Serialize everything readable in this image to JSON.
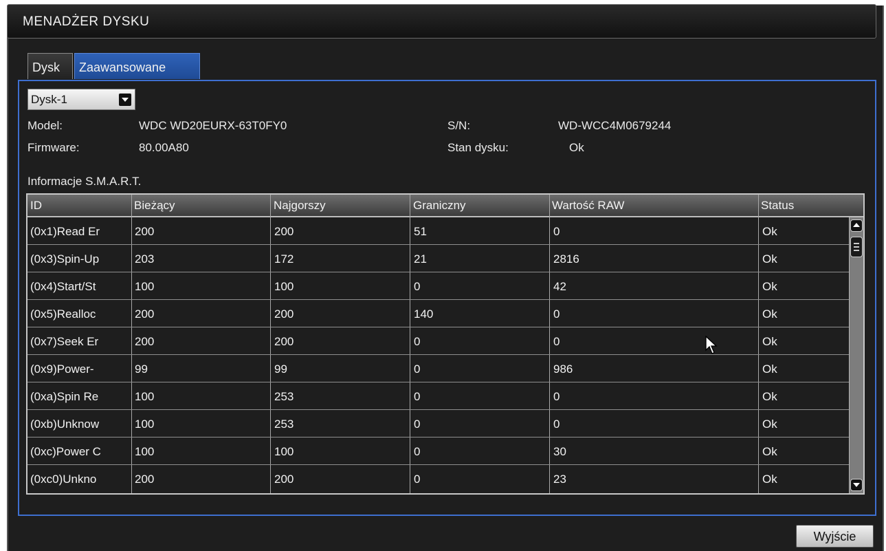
{
  "window": {
    "title": "MENADŻER DYSKU"
  },
  "tabs": [
    {
      "label": "Dysk"
    },
    {
      "label": "Zaawansowane"
    }
  ],
  "disk_select": {
    "value": "Dysk-1"
  },
  "info": {
    "model_label": "Model:",
    "model_value": "WDC WD20EURX-63T0FY0",
    "sn_label": "S/N:",
    "sn_value": "WD-WCC4M0679244",
    "firmware_label": "Firmware:",
    "firmware_value": "80.00A80",
    "status_label": "Stan dysku:",
    "status_value": "Ok"
  },
  "smart": {
    "heading": "Informacje S.M.A.R.T.",
    "columns": [
      "ID",
      "Bieżący",
      "Najgorszy",
      "Graniczny",
      "Wartość RAW",
      "Status"
    ],
    "rows": [
      [
        "(0x1)Read Er",
        "200",
        "200",
        "51",
        "0",
        "Ok"
      ],
      [
        "(0x3)Spin-Up",
        "203",
        "172",
        "21",
        "2816",
        "Ok"
      ],
      [
        "(0x4)Start/St",
        "100",
        "100",
        "0",
        "42",
        "Ok"
      ],
      [
        "(0x5)Realloc",
        "200",
        "200",
        "140",
        "0",
        "Ok"
      ],
      [
        "(0x7)Seek Er",
        "200",
        "200",
        "0",
        "0",
        "Ok"
      ],
      [
        "(0x9)Power-",
        "99",
        "99",
        "0",
        "986",
        "Ok"
      ],
      [
        "(0xa)Spin Re",
        "100",
        "253",
        "0",
        "0",
        "Ok"
      ],
      [
        "(0xb)Unknow",
        "100",
        "253",
        "0",
        "0",
        "Ok"
      ],
      [
        "(0xc)Power C",
        "100",
        "100",
        "0",
        "30",
        "Ok"
      ],
      [
        "(0xc0)Unkno",
        "200",
        "200",
        "0",
        "23",
        "Ok"
      ]
    ]
  },
  "exit_button": {
    "label": "Wyjście"
  },
  "colors": {
    "accent": "#3e6fd0",
    "background": "#1e1e1e",
    "header": "#5a5a5a"
  }
}
